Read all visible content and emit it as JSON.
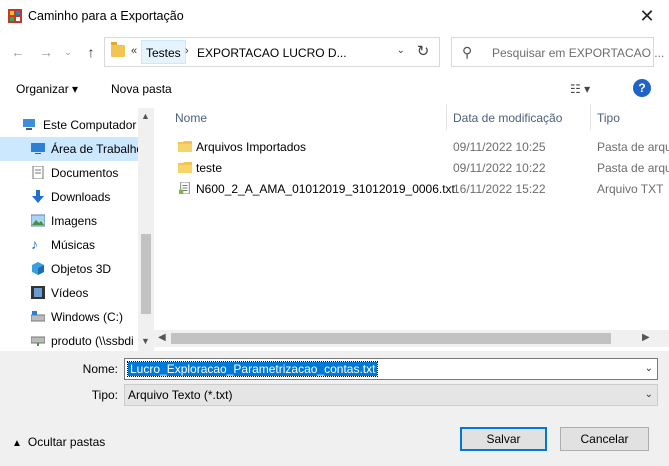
{
  "window": {
    "title": "Caminho para a Exportação",
    "close_glyph": "✕"
  },
  "nav": {
    "breadcrumb_overflow": "«",
    "breadcrumb": [
      "Testes",
      "EXPORTACAO LUCRO D..."
    ],
    "search_placeholder": "Pesquisar em EXPORTACAO ..."
  },
  "toolbar": {
    "organize_label": "Organizar ▾",
    "new_folder_label": "Nova pasta",
    "help_label": "?"
  },
  "sidebar": {
    "items": [
      {
        "label": "Este Computador",
        "icon": "computer-icon"
      },
      {
        "label": "Área de Trabalho",
        "icon": "desktop-icon",
        "selected": true
      },
      {
        "label": "Documentos",
        "icon": "documents-icon"
      },
      {
        "label": "Downloads",
        "icon": "downloads-icon"
      },
      {
        "label": "Imagens",
        "icon": "pictures-icon"
      },
      {
        "label": "Músicas",
        "icon": "music-icon"
      },
      {
        "label": "Objetos 3D",
        "icon": "3d-objects-icon"
      },
      {
        "label": "Vídeos",
        "icon": "videos-icon"
      },
      {
        "label": "Windows (C:)",
        "icon": "drive-icon"
      },
      {
        "label": "produto (\\\\ssbdi",
        "icon": "network-drive-icon"
      }
    ]
  },
  "filelist": {
    "columns": {
      "name": "Nome",
      "date": "Data de modificação",
      "type": "Tipo"
    },
    "rows": [
      {
        "name": "Arquivos Importados",
        "date": "09/11/2022 10:25",
        "type": "Pasta de arqu",
        "icon": "folder-icon"
      },
      {
        "name": "teste",
        "date": "09/11/2022 10:22",
        "type": "Pasta de arqu",
        "icon": "folder-icon"
      },
      {
        "name": "N600_2_A_AMA_01012019_31012019_0006.txt",
        "date": "16/11/2022 15:22",
        "type": "Arquivo TXT",
        "icon": "text-file-icon"
      }
    ]
  },
  "form": {
    "name_label": "Nome:",
    "name_value": "Lucro_Exploracao_Parametrizacao_contas.txt",
    "type_label": "Tipo:",
    "type_value": "Arquivo Texto (*.txt)",
    "hide_folders_label": "Ocultar pastas",
    "save_label": "Salvar",
    "cancel_label": "Cancelar"
  },
  "colors": {
    "accent": "#0078d7",
    "selection": "#cce8ff",
    "folder": "#f1c453"
  }
}
